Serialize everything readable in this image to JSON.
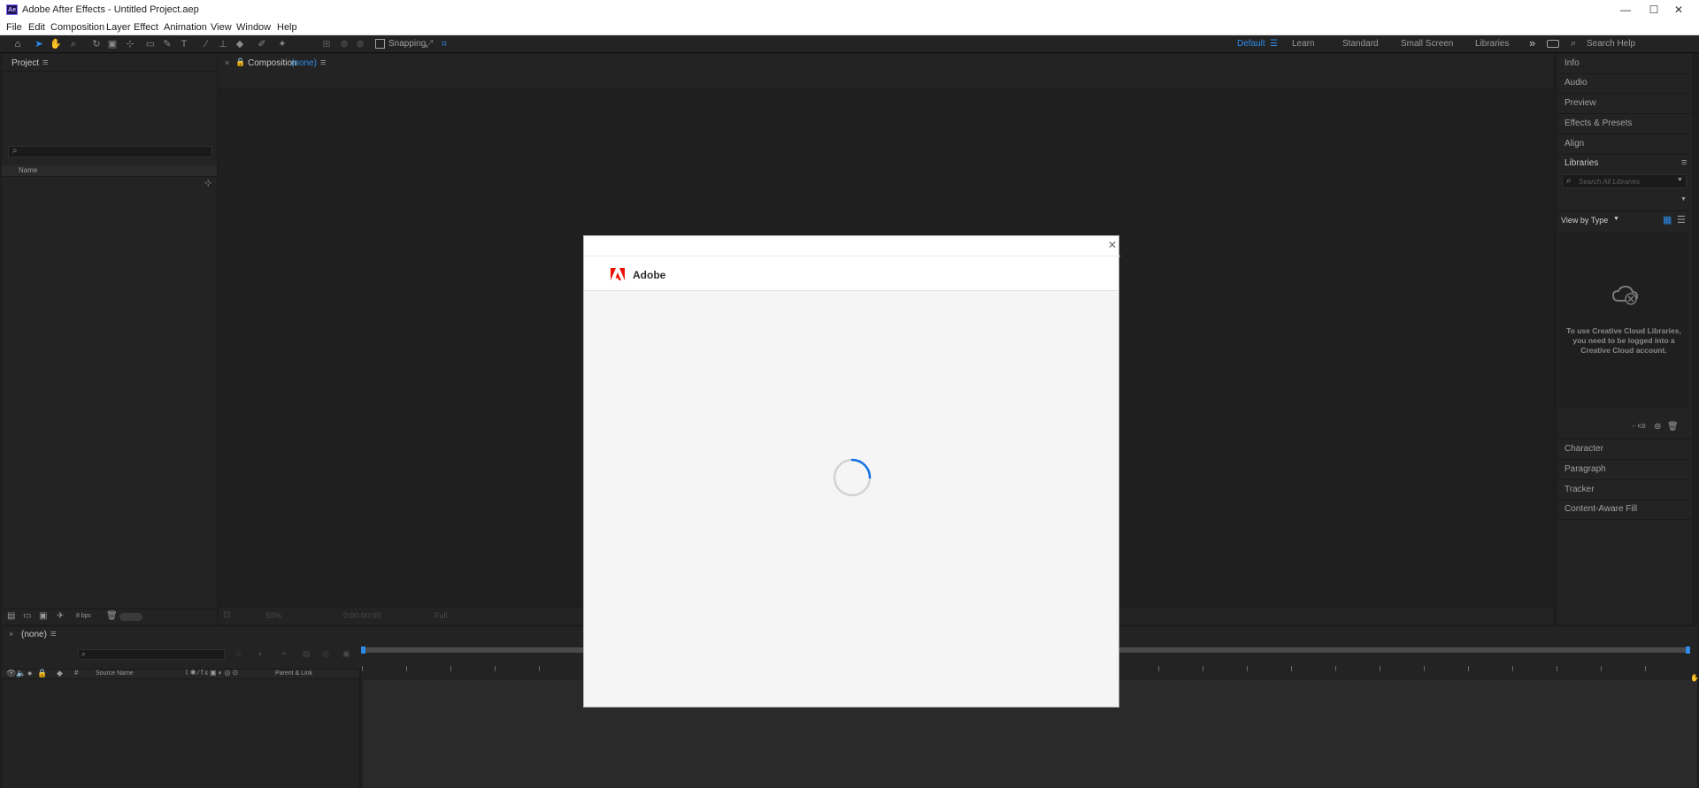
{
  "window": {
    "app_icon": "Ae",
    "title": "Adobe After Effects - Untitled Project.aep",
    "min_glyph": "—",
    "max_glyph": "☐",
    "close_glyph": "✕"
  },
  "menu": [
    "File",
    "Edit",
    "Composition",
    "Layer",
    "Effect",
    "Animation",
    "View",
    "Window",
    "Help"
  ],
  "toolbar": {
    "snapping_label": "Snapping",
    "workspaces": [
      "Default",
      "Learn",
      "Standard",
      "Small Screen",
      "Libraries"
    ],
    "active_workspace": "Default",
    "search_placeholder": "Search Help",
    "overflow_glyph": "»"
  },
  "project_panel": {
    "title": "Project",
    "column_name": "Name",
    "bpc": "8 bpc"
  },
  "composition_panel": {
    "prefix": "Composition",
    "name": "(none)",
    "zoom": "50%",
    "timecode": "0:00:00:00",
    "resolution": "Full"
  },
  "right_panels": {
    "items_top": [
      "Info",
      "Audio",
      "Preview",
      "Effects & Presets",
      "Align"
    ],
    "libraries_title": "Libraries",
    "libraries_search_placeholder": "Search All Libraries",
    "view_by": "View by Type",
    "message": "To use Creative Cloud Libraries, you need to be logged into a Creative Cloud account.",
    "storage_label": "-- KB",
    "items_bottom": [
      "Character",
      "Paragraph",
      "Tracker",
      "Content-Aware Fill"
    ]
  },
  "timeline": {
    "tab_label": "(none)",
    "col_source": "Source Name",
    "col_parent": "Parent & Link"
  },
  "dialog": {
    "brand": "Adobe",
    "close_glyph": "✕"
  },
  "colors": {
    "accent": "#2d8ceb",
    "spinner": "#1473e6",
    "adobe_red": "#eb1000"
  }
}
